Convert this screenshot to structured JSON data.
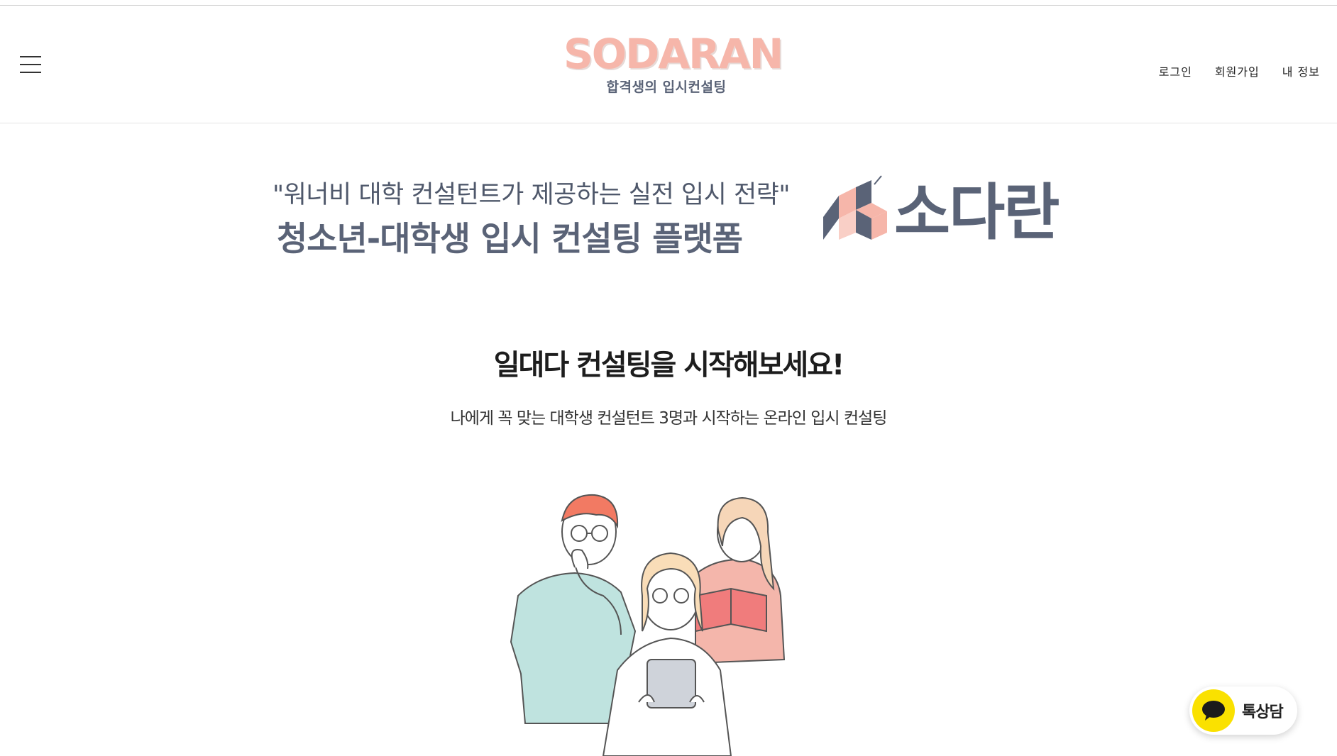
{
  "header": {
    "menu_icon": "hamburger-menu-icon",
    "logo": {
      "wordmark": "SODARAN",
      "tagline": "합격생의 입시컨설팅",
      "wordmark_color": "#f6b6aa",
      "tagline_color": "#5a6377"
    },
    "auth_links": [
      {
        "label": "로그인"
      },
      {
        "label": "회원가입"
      },
      {
        "label": "내 정보"
      }
    ]
  },
  "hero": {
    "quote": "\"워너비 대학 컨설턴트가 제공하는 실전 입시 전략\"",
    "title": "청소년-대학생 입시 컨설팅 플랫폼",
    "brand_name": "소다란",
    "brand_color": "#5a6377",
    "accent_color": "#f6b6aa"
  },
  "cta": {
    "heading": "일대다 컨설팅을 시작해보세요!",
    "subheading": "나에게 꼭 맞는 대학생 컨설턴트 3명과 시작하는 온라인 입시 컨설팅"
  },
  "illustration": {
    "icon": "three-students-illustration"
  },
  "floating_chat": {
    "label": "톡상담",
    "icon": "kakao-speech-bubble-icon",
    "color": "#fae100"
  }
}
